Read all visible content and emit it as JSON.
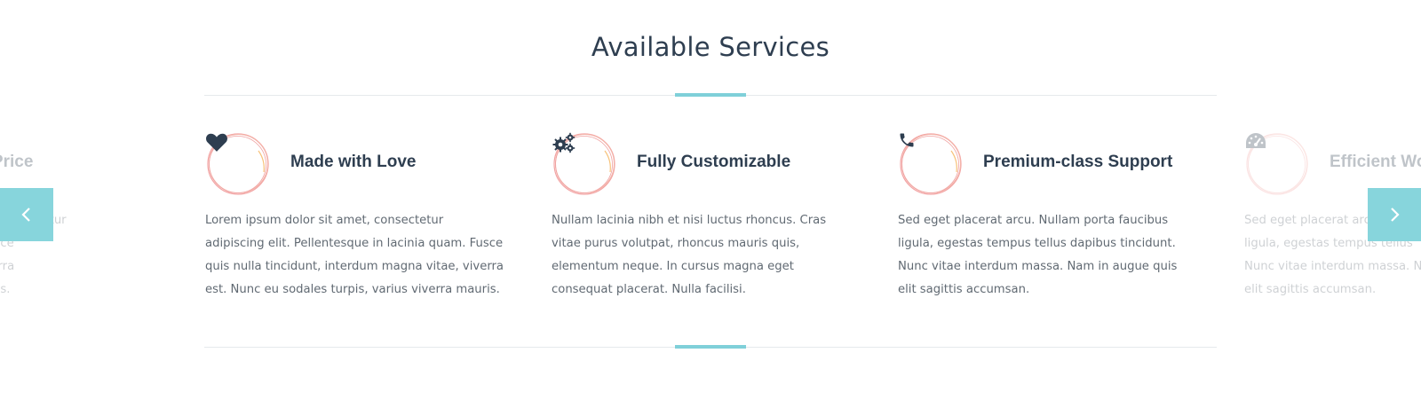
{
  "section": {
    "title": "Available Services"
  },
  "colors": {
    "accent": "#7fd0d9",
    "arrow_bg": "#87d5dc",
    "ring": "#f2a3a3",
    "heading": "#2e3e50",
    "body": "#616a73"
  },
  "services": [
    {
      "title": "nable Price",
      "icon": "price-tag-icon",
      "lines": [
        "ectetur",
        "que in lacinia quam. Fusce",
        "rdum magna vitae, viverra",
        "pis, varius viverra mauris."
      ]
    },
    {
      "title": "Made with Love",
      "icon": "heart-icon",
      "lines": [
        "Lorem ipsum dolor sit amet, consectetur",
        "adipiscing elit. Pellentesque in lacinia quam. Fusce",
        "quis nulla tincidunt, interdum magna vitae, viverra",
        "est. Nunc eu sodales turpis, varius viverra mauris."
      ]
    },
    {
      "title": "Fully Customizable",
      "icon": "gears-icon",
      "lines": [
        "Nullam lacinia nibh et nisi luctus rhoncus. Cras",
        "vitae purus volutpat, rhoncus mauris quis,",
        "elementum neque. In cursus magna eget",
        "consequat placerat. Nulla facilisi."
      ]
    },
    {
      "title": "Premium-class Support",
      "icon": "phone-icon",
      "lines": [
        "Sed eget placerat arcu. Nullam porta faucibus",
        "ligula, egestas tempus tellus dapibus tincidunt.",
        "Nunc vitae interdum massa. Nam in augue quis",
        "elit sagittis accumsan."
      ]
    },
    {
      "title": "Efficient Wo",
      "icon": "speedometer-icon",
      "lines": [
        "Sed eget placerat arcu",
        "ligula, egestas tempus tellus",
        "Nunc vitae interdum massa. N",
        "elit sagittis accumsan."
      ]
    }
  ],
  "navigation": {
    "prev_icon": "chevron-left-icon",
    "next_icon": "chevron-right-icon"
  }
}
